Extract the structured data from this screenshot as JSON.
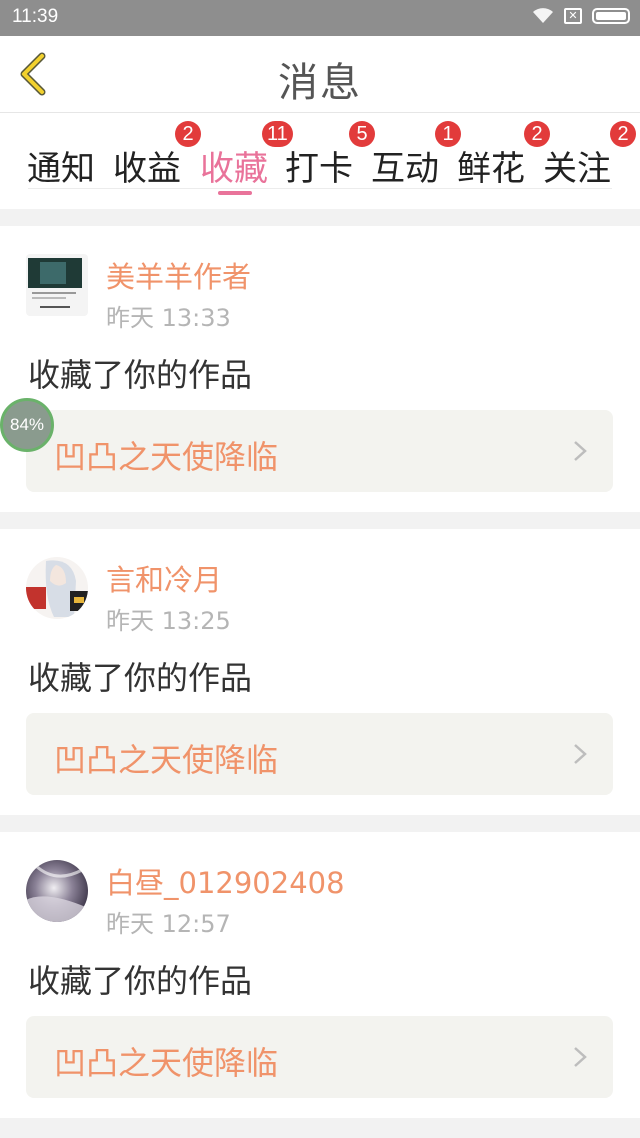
{
  "status_bar": {
    "time": "11:39"
  },
  "header": {
    "title": "消息"
  },
  "tabs": [
    {
      "label": "通知",
      "badge": ""
    },
    {
      "label": "收益",
      "badge": "2"
    },
    {
      "label": "收藏",
      "badge": "11"
    },
    {
      "label": "打卡",
      "badge": "5"
    },
    {
      "label": "互动",
      "badge": "1"
    },
    {
      "label": "鲜花",
      "badge": "2"
    },
    {
      "label": "关注",
      "badge": "2"
    }
  ],
  "messages": [
    {
      "user": "美羊羊作者",
      "time": "昨天 13:33",
      "action": "收藏了你的作品",
      "work_title": "凹凸之天使降临",
      "avatar_icon": "user-avatar"
    },
    {
      "user": "言和冷月",
      "time": "昨天 13:25",
      "action": "收藏了你的作品",
      "work_title": "凹凸之天使降临",
      "avatar_icon": "user-avatar"
    },
    {
      "user": "白昼_012902408",
      "time": "昨天 12:57",
      "action": "收藏了你的作品",
      "work_title": "凹凸之天使降临",
      "avatar_icon": "user-avatar"
    }
  ],
  "floating_indicator": {
    "text": "84%"
  },
  "colors": {
    "accent": "#e9739a",
    "username": "#f0936a",
    "badge": "#e23b3b",
    "back_arrow": "#f2d12e"
  }
}
